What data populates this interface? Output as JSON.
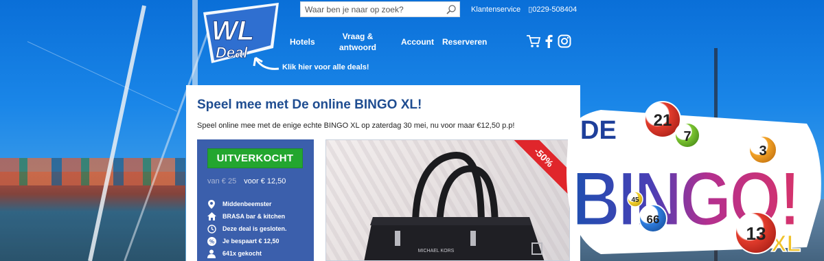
{
  "header": {
    "logo_text": "WL Deal",
    "search_placeholder": "Waar ben je naar op zoek?",
    "service_label": "Klantenservice",
    "phone": "0229-508404",
    "nav": [
      "Hotels",
      "Vraag &",
      "antwoord",
      "Account",
      "Reserveren"
    ],
    "all_deals_link": "Klik hier voor alle deals!"
  },
  "deal": {
    "title": "Speel mee met De online BINGO XL!",
    "subtitle": "Speel online mee met de enige echte BINGO XL op zaterdag 30 mei, nu voor maar €12,50 p.p!",
    "status_button": "UITVERKOCHT",
    "old_price": "van € 25",
    "new_price": "voor € 12,50",
    "info": [
      "Middenbeemster",
      "BRASA bar & kitchen",
      "Deze deal is gesloten.",
      "Je bespaart € 12,50",
      "641x gekocht"
    ],
    "discount_badge": "-50%",
    "product_brand": "MICHAEL KORS"
  },
  "promo": {
    "word_de": "DE",
    "word_bingo": "BINGO!",
    "word_xl": "XL",
    "balls": [
      "21",
      "7",
      "3",
      "45",
      "66",
      "13"
    ]
  },
  "colors": {
    "brand_blue": "#1f4d91",
    "panel_blue": "#3b5fac",
    "sold_green": "#23a62f",
    "ribbon_red": "#e0262b"
  }
}
